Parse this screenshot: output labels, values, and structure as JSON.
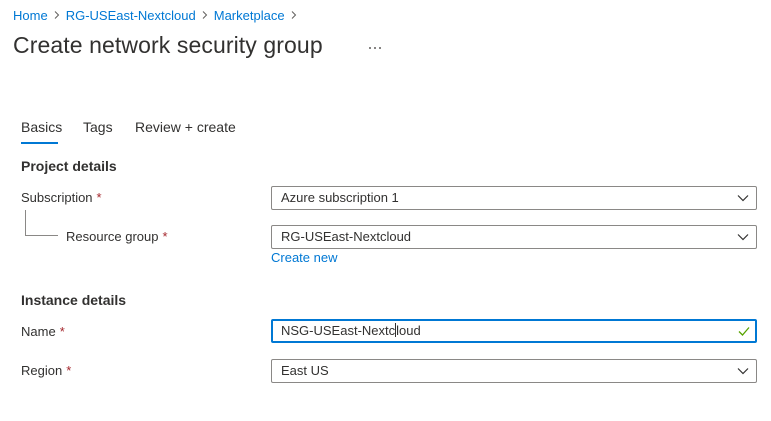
{
  "breadcrumb": {
    "items": [
      "Home",
      "RG-USEast-Nextcloud",
      "Marketplace"
    ]
  },
  "header": {
    "title": "Create network security group",
    "more_label": "..."
  },
  "tabs": [
    {
      "label": "Basics",
      "active": true
    },
    {
      "label": "Tags",
      "active": false
    },
    {
      "label": "Review + create",
      "active": false
    }
  ],
  "sections": {
    "project_details": "Project details",
    "instance_details": "Instance details"
  },
  "form": {
    "subscription": {
      "label": "Subscription",
      "required_mark": "*",
      "value": "Azure subscription 1"
    },
    "resource_group": {
      "label": "Resource group",
      "required_mark": "*",
      "value": "RG-USEast-Nextcloud",
      "create_new": "Create new"
    },
    "name": {
      "label": "Name",
      "required_mark": "*",
      "value_before_caret": "NSG-USEast-Nextc",
      "value_after_caret": "loud",
      "valid": true
    },
    "region": {
      "label": "Region",
      "required_mark": "*",
      "value": "East US"
    }
  },
  "colors": {
    "accent": "#0078d4",
    "required": "#a4262c",
    "valid": "#57a300"
  }
}
